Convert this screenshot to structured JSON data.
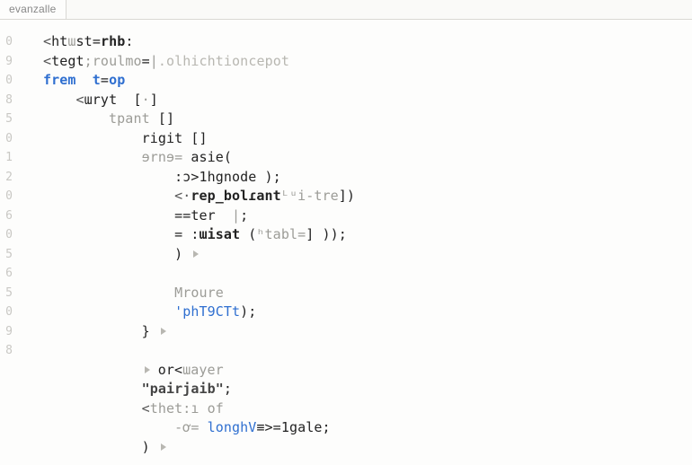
{
  "tab": {
    "label": "evanzalle"
  },
  "gutter": [
    "0",
    "9",
    "",
    "0",
    "8",
    "5",
    "",
    "0",
    "1",
    "2",
    "",
    "0",
    "6",
    "0",
    "",
    "5",
    "6",
    "5",
    "",
    "0",
    "",
    "9",
    "8",
    ""
  ],
  "code": {
    "lines": [
      {
        "indent": 0,
        "spans": [
          {
            "t": "<",
            "c": "tok-tag"
          },
          {
            "t": "ht",
            "c": "tok-dark"
          },
          {
            "t": "ɯ",
            "c": "tok-grey"
          },
          {
            "t": "st",
            "c": "tok-dark"
          },
          {
            "t": "=",
            "c": "tok-dark"
          },
          {
            "t": "rhb",
            "c": "tok-dark tok-bold"
          },
          {
            "t": ":",
            "c": "tok-dark"
          }
        ]
      },
      {
        "indent": 0,
        "spans": [
          {
            "t": "<",
            "c": "tok-tag"
          },
          {
            "t": "tegt",
            "c": "tok-dark"
          },
          {
            "t": ";roulmo",
            "c": "tok-grey"
          },
          {
            "t": "=",
            "c": "tok-dark"
          },
          {
            "t": "|",
            "c": "tok-grey"
          },
          {
            "t": ".olhichtioncepot",
            "c": "tok-faint"
          }
        ]
      },
      {
        "indent": 0,
        "spans": [
          {
            "t": "frem  t",
            "c": "tok-blue"
          },
          {
            "t": "=",
            "c": "tok-dark"
          },
          {
            "t": "op",
            "c": "tok-blue"
          }
        ]
      },
      {
        "indent": 1,
        "spans": [
          {
            "t": "<",
            "c": "tok-tag"
          },
          {
            "t": "ɯryt  ",
            "c": "tok-dark"
          },
          {
            "t": "[",
            "c": "tok-dark"
          },
          {
            "t": "·",
            "c": "tok-grey"
          },
          {
            "t": "]",
            "c": "tok-dark"
          }
        ]
      },
      {
        "indent": 2,
        "spans": [
          {
            "t": "tpant ",
            "c": "tok-grey"
          },
          {
            "t": "[]",
            "c": "tok-dark"
          }
        ]
      },
      {
        "indent": 3,
        "spans": [
          {
            "t": "rigit []",
            "c": "tok-dark"
          }
        ]
      },
      {
        "indent": 3,
        "spans": [
          {
            "t": "ɘrnɘ= ",
            "c": "tok-grey"
          },
          {
            "t": "asie",
            "c": "tok-dark"
          },
          {
            "t": "(",
            "c": "tok-dark"
          }
        ]
      },
      {
        "indent": 4,
        "spans": [
          {
            "t": ":ɔ>",
            "c": "tok-dark"
          },
          {
            "t": "1hgnode );",
            "c": "tok-dark"
          }
        ]
      },
      {
        "indent": 4,
        "spans": [
          {
            "t": "<·",
            "c": "tok-tag"
          },
          {
            "t": "rep_bolɾant",
            "c": "tok-dark tok-bold"
          },
          {
            "t": "ᴸᵘi-tre",
            "c": "tok-grey"
          },
          {
            "t": "])",
            "c": "tok-dark"
          }
        ]
      },
      {
        "indent": 4,
        "spans": [
          {
            "t": "==",
            "c": "tok-dark"
          },
          {
            "t": "ter  ",
            "c": "tok-dark"
          },
          {
            "t": "|",
            "c": "tok-grey"
          },
          {
            "t": ";",
            "c": "tok-dark"
          }
        ]
      },
      {
        "indent": 4,
        "spans": [
          {
            "t": "= :",
            "c": "tok-dark"
          },
          {
            "t": "ɯisat",
            "c": "tok-dark tok-bold"
          },
          {
            "t": " (",
            "c": "tok-dark"
          },
          {
            "t": "ʰtabl=",
            "c": "tok-grey"
          },
          {
            "t": "] ));",
            "c": "tok-dark"
          }
        ]
      },
      {
        "indent": 4,
        "spans": [
          {
            "t": ") ",
            "c": "tok-dark"
          },
          {
            "t": "__TRI__",
            "c": ""
          }
        ]
      },
      {
        "indent": 0,
        "spans": []
      },
      {
        "indent": 4,
        "spans": [
          {
            "t": "Mroure",
            "c": "tok-grey"
          }
        ]
      },
      {
        "indent": 4,
        "spans": [
          {
            "t": "'phT9CTt",
            "c": "tok-blue2"
          },
          {
            "t": ");",
            "c": "tok-dark"
          }
        ]
      },
      {
        "indent": 3,
        "spans": [
          {
            "t": "} ",
            "c": "tok-dark"
          },
          {
            "t": "__TRI__",
            "c": ""
          }
        ]
      },
      {
        "indent": 0,
        "spans": []
      },
      {
        "indent": 3,
        "spans": [
          {
            "t": "__TRI__",
            "c": ""
          },
          {
            "t": " or<",
            "c": "tok-dark"
          },
          {
            "t": "ɯayer",
            "c": "tok-grey"
          }
        ]
      },
      {
        "indent": 3,
        "spans": [
          {
            "t": "\"pairjaib\"",
            "c": "tok-str tok-bold"
          },
          {
            "t": ";",
            "c": "tok-dark"
          }
        ]
      },
      {
        "indent": 3,
        "spans": [
          {
            "t": "<",
            "c": "tok-tag"
          },
          {
            "t": "thet:ı of",
            "c": "tok-grey"
          }
        ]
      },
      {
        "indent": 4,
        "spans": [
          {
            "t": "-ơ= ",
            "c": "tok-grey"
          },
          {
            "t": "longhV",
            "c": "tok-blue2"
          },
          {
            "t": "≡>=",
            "c": "tok-dark"
          },
          {
            "t": "1gale",
            "c": "tok-dark"
          },
          {
            "t": ";",
            "c": "tok-dark"
          }
        ]
      },
      {
        "indent": 3,
        "spans": [
          {
            "t": ") ",
            "c": "tok-dark"
          },
          {
            "t": "__TRI__",
            "c": ""
          }
        ]
      }
    ]
  }
}
